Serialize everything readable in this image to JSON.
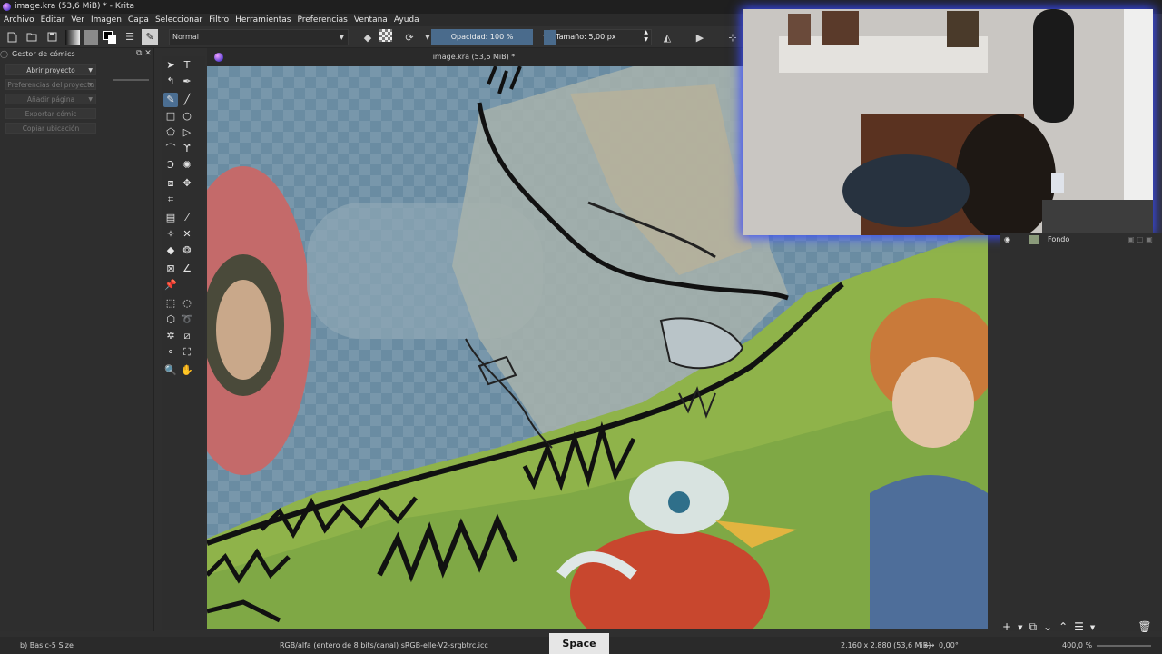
{
  "window": {
    "title": "image.kra (53,6 MiB) * - Krita"
  },
  "menu": [
    "Archivo",
    "Editar",
    "Ver",
    "Imagen",
    "Capa",
    "Seleccionar",
    "Filtro",
    "Herramientas",
    "Preferencias",
    "Ventana",
    "Ayuda"
  ],
  "toolbar": {
    "blend_mode": "Normal",
    "opacity_label": "Opacidad: 100 %",
    "size_label": "Tamaño: 5,00 px"
  },
  "comics_docker": {
    "title": "Gestor de cómics",
    "buttons": [
      {
        "label": "Abrir proyecto",
        "dropdown": true,
        "enabled": true
      },
      {
        "label": "Preferencias del proyecto",
        "dropdown": true,
        "enabled": false
      },
      {
        "label": "Añadir página",
        "dropdown": true,
        "enabled": false
      },
      {
        "label": "Exportar cómic",
        "dropdown": false,
        "enabled": false
      },
      {
        "label": "Copiar ubicación",
        "dropdown": false,
        "enabled": false
      }
    ]
  },
  "canvas": {
    "document_title": "image.kra (53,6 MiB) *"
  },
  "layers": {
    "items": [
      {
        "name": "Fondo"
      }
    ]
  },
  "status": {
    "brush_preset": "b) Basic-5 Size",
    "color_space": "RGB/alfa (entero de 8 bits/canal)  sRGB-elle-V2-srgbtrc.icc",
    "key_overlay": "Space",
    "image_size": "2.160 x 2.880 (53,6 MiB)",
    "rotation": "0,00°",
    "zoom": "400,0 %"
  },
  "colors": {
    "accent": "#4a6b8c",
    "webcam_glow": "#3a4cff",
    "canvas_sky": "#6f93a8",
    "canvas_grass": "#8fb34a"
  }
}
